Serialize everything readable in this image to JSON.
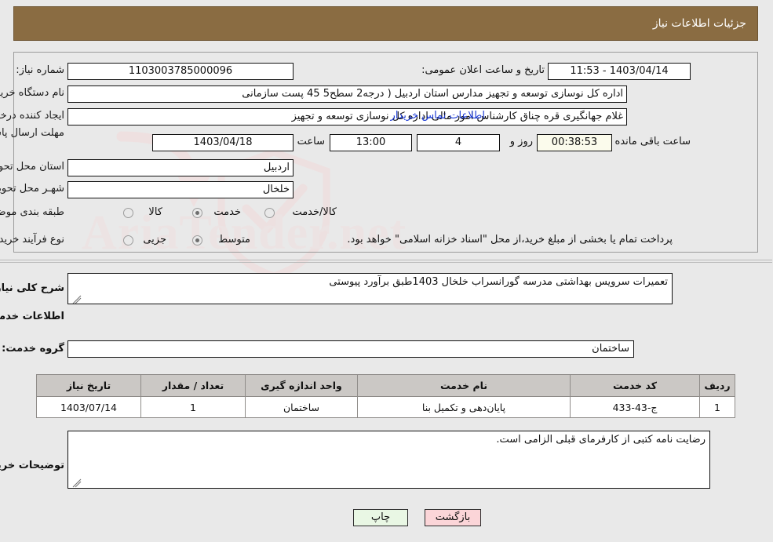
{
  "header": {
    "title": "جزئیات اطلاعات نیاز"
  },
  "form": {
    "need_number_label": "شماره نیاز:",
    "need_number": "1103003785000096",
    "public_announce_label": "تاریخ و ساعت اعلان عمومی:",
    "public_announce_value": "1403/04/14 - 11:53",
    "buyer_org_label": "نام دستگاه خریدار:",
    "buyer_org": "اداره کل نوسازی   توسعه و تجهیز مدارس استان اردبیل ( درجه2  سطح5  45 پست سازمانی",
    "requester_label": "ایجاد کننده درخواست:",
    "requester": "غلام جهانگیری قره چناق کارشناس امور مالی اداره کل نوسازی   توسعه و تجهیز",
    "contact_link": "اطلاعات تماس خریدار",
    "deadline_label": "مهلت ارسال پاسخ: تا تاریخ:",
    "deadline_date": "1403/04/18",
    "hour_label": "ساعت",
    "deadline_time": "13:00",
    "days_left": "4",
    "days_sep_label": "روز و",
    "countdown": "00:38:53",
    "countdown_suffix_label": "ساعت باقی مانده",
    "province_label": "استان محل تحویل:",
    "province": "اردبیل",
    "city_label": "شهـر محل تحویل:",
    "city": "خلخال",
    "category_label": "طبقه بندی موضوعی:",
    "category_options": [
      "کالا",
      "خدمت",
      "کالا/خدمت"
    ],
    "category_selected_index": 1,
    "process_label": "نوع فرآیند خرید :",
    "process_options": [
      "جزیی",
      "متوسط"
    ],
    "process_selected_index": 1,
    "process_note": "پرداخت تمام یا بخشی از مبلغ خرید،از محل \"اسناد خزانه اسلامی\" خواهد بود."
  },
  "description": {
    "label": "شرح کلی نیاز:",
    "value": "تعمیرات سرویس بهداشتی مدرسه گورانسراب خلخال 1403طبق برآورد پیوستی"
  },
  "services": {
    "section_title": "اطلاعات خدمات مورد نیاز",
    "group_label": "گروه خدمت:",
    "group_value": "ساختمان",
    "table": {
      "columns": [
        "ردیف",
        "کد خدمت",
        "نام خدمت",
        "واحد اندازه گیری",
        "تعداد / مقدار",
        "تاریخ نیاز"
      ],
      "rows": [
        {
          "index": "1",
          "code": "ج-43-433",
          "name": "پایان‌دهی و تکمیل بنا",
          "unit": "ساختمان",
          "qty": "1",
          "date": "1403/07/14"
        }
      ]
    }
  },
  "notes": {
    "label": "توضیحات خریدار:",
    "value": "رضایت نامه کتبی از کارفرمای قبلی الزامی است."
  },
  "footer": {
    "print_label": "چاپ",
    "back_label": "بازگشت"
  },
  "watermark": {
    "text": "AriaTender.net"
  },
  "colors": {
    "header_bg": "#8a6c42",
    "page_bg": "#e9e9e9",
    "link": "#1a3ad6",
    "table_header": "#cbc8c5",
    "print_btn": "#e9f7e4",
    "back_btn": "#fbd5d8",
    "timer_bg": "#fbfbec"
  }
}
